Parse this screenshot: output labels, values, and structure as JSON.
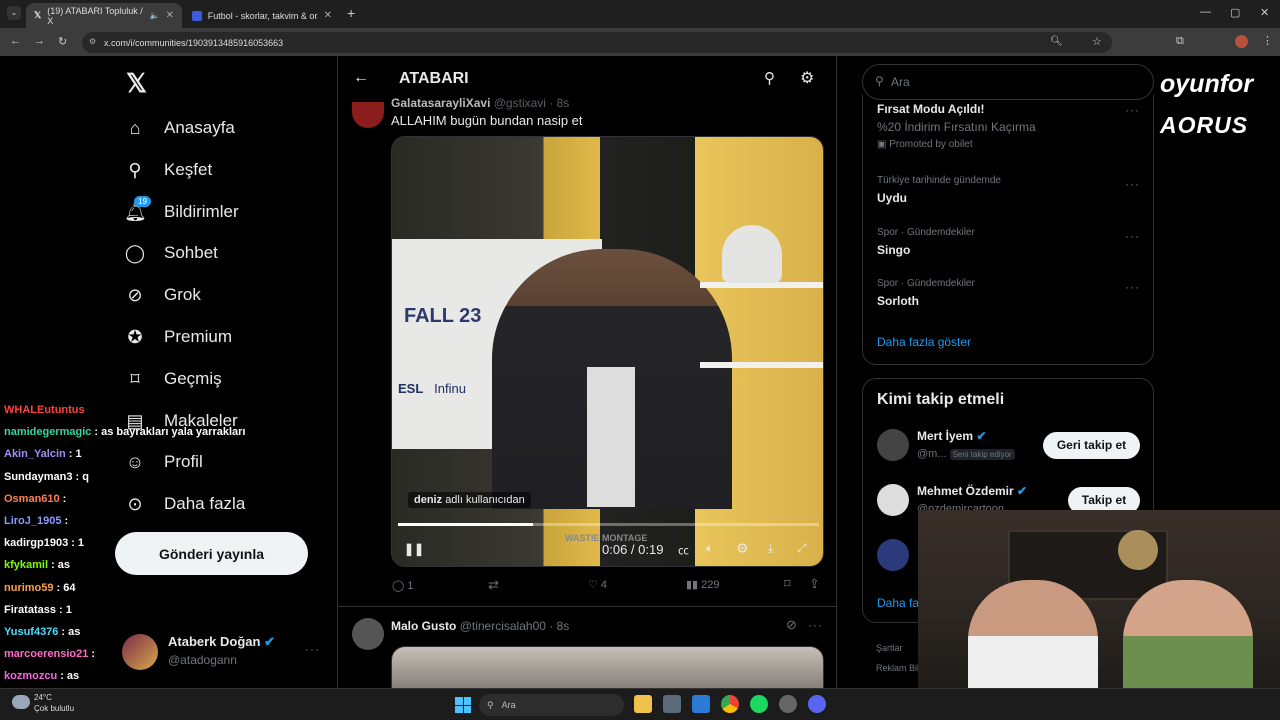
{
  "browser": {
    "tabs": [
      {
        "label": "(19) ATABARI Topluluk / X"
      },
      {
        "label": "Futbol - skorlar, takvim & oran"
      }
    ],
    "new_tab": "+",
    "url": "x.com/i/communities/1903913485916053663"
  },
  "sidebar": {
    "items": [
      {
        "label": "Anasayfa",
        "icon": "home-icon"
      },
      {
        "label": "Keşfet",
        "icon": "search-icon"
      },
      {
        "label": "Bildirimler",
        "icon": "bell-icon",
        "badge": "19"
      },
      {
        "label": "Sohbet",
        "icon": "chat-icon"
      },
      {
        "label": "Grok",
        "icon": "grok-icon"
      },
      {
        "label": "Premium",
        "icon": "premium-icon"
      },
      {
        "label": "Geçmiş",
        "icon": "bookmark-icon"
      },
      {
        "label": "Makaleler",
        "icon": "article-icon"
      },
      {
        "label": "Profil",
        "icon": "profile-icon"
      },
      {
        "label": "Daha fazla",
        "icon": "more-icon"
      }
    ],
    "post_button": "Gönderi yayınla",
    "account": {
      "name": "Ataberk Doğan",
      "handle": "@atadogann"
    }
  },
  "header": {
    "title": "ATABARI"
  },
  "tweet1": {
    "author": "GalatasarayliXavi",
    "handle": "@gstixavi",
    "time": "· 8s",
    "text": "ALLAHIM bugün bundan nasip et",
    "video": {
      "time": "0:06 / 0:19",
      "progress": 0.32,
      "tag_user": "deniz",
      "tag_suffix": "adlı kullanıcıdan",
      "wall_text": "FALL 23",
      "logo_text": "ESL",
      "logo_text2": "Infinu",
      "watermark": "WASTIE MONTAGE"
    },
    "stats": {
      "replies": "1",
      "likes": "4",
      "views": "229"
    }
  },
  "tweet2": {
    "author": "Malo Gusto",
    "handle": "@tinercisalah00",
    "time": "· 8s"
  },
  "search": {
    "placeholder": "Ara"
  },
  "trends": {
    "promo": {
      "title": "Fırsat Modu Açıldı!",
      "desc": "%20 İndirim Fırsatını Kaçırma",
      "promoted": "Promoted by obilet"
    },
    "items": [
      {
        "context": "Türkiye tarihinde gündemde",
        "title": "Uydu"
      },
      {
        "context": "Spor · Gündemdekiler",
        "title": "Singo"
      },
      {
        "context": "Spor · Gündemdekiler",
        "title": "Sorloth"
      }
    ],
    "show_more": "Daha fazla göster"
  },
  "who_to_follow": {
    "title": "Kimi takip etmeli",
    "users": [
      {
        "name": "Mert İyem",
        "handle": "@m...",
        "follows_you": "Seni takip ediyor",
        "button": "Geri takip et"
      },
      {
        "name": "Mehmet Özdemir",
        "handle": "@ozdemircartoon",
        "button": "Takip et"
      }
    ],
    "show_more": "Daha fa"
  },
  "footer": {
    "terms": "Şartlar",
    "ads": "Reklam Bil"
  },
  "overlay": {
    "brand1": "oyunfor",
    "brand2": "AORUS"
  },
  "chat": [
    {
      "user": "WHALEutuntus",
      "msg": "",
      "color": "#ff4040"
    },
    {
      "user": "namidegermagic",
      "msg": ": as bayrakları yala yarrakları",
      "color": "#38d39f"
    },
    {
      "user": "Akin_Yalcin",
      "msg": ": 1",
      "color": "#a78bfa"
    },
    {
      "user": "Sundayman3",
      "msg": ": q",
      "color": "#ffffff"
    },
    {
      "user": "Osman610",
      "msg": ":",
      "color": "#ff7f50"
    },
    {
      "user": "LiroJ_1905",
      "msg": ":",
      "color": "#8b9cff"
    },
    {
      "user": "kadirgp1903",
      "msg": ": 1",
      "color": "#ffffff"
    },
    {
      "user": "kfykamil",
      "msg": ": as",
      "color": "#7cfc00"
    },
    {
      "user": "nurimo59",
      "msg": ": 64",
      "color": "#ff9f43"
    },
    {
      "user": "Firatatass",
      "msg": ": 1",
      "color": "#ffffff"
    },
    {
      "user": "Yusuf4376",
      "msg": ": as",
      "color": "#48dbfb"
    },
    {
      "user": "marcoerensio21",
      "msg": ":",
      "color": "#ff6bcb"
    },
    {
      "user": "kozmozcu",
      "msg": ": as",
      "color": "#f368e0"
    }
  ],
  "taskbar": {
    "search": "Ara",
    "weather_temp": "24°C",
    "weather_desc": "Çok bulutlu"
  },
  "colors": {
    "accent": "#1d9bf0",
    "bg": "#000000",
    "border": "#2f3336",
    "muted": "#71767b"
  }
}
